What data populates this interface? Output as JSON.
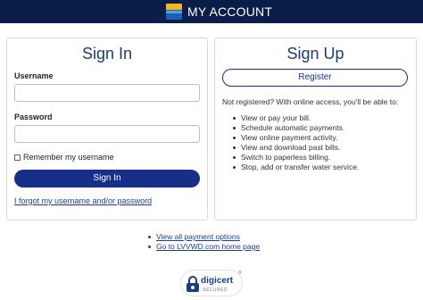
{
  "header": {
    "title": "MY ACCOUNT",
    "logo_icon": "lvvwd-logo-icon"
  },
  "signin": {
    "title": "Sign In",
    "username_label": "Username",
    "username_value": "",
    "password_label": "Password",
    "password_value": "",
    "remember_label": "Remember my username",
    "remember_checked": false,
    "button_label": "Sign In",
    "forgot_link": "I forgot my username and/or password"
  },
  "signup": {
    "title": "Sign Up",
    "button_label": "Register",
    "intro": "Not registered? With online access, you'll be able to:",
    "benefits": [
      "View or pay your bill.",
      "Schedule automatic payments.",
      "View online payment activity.",
      "View and download past bills.",
      "Switch to paperless billing.",
      "Stop, add or transfer water service."
    ]
  },
  "footer_links": [
    "View all payment options",
    "Go to LVVWD.com home page"
  ],
  "seal": {
    "name": "digicert",
    "sub": "SECURED",
    "icon": "padlock-icon"
  },
  "colors": {
    "header_bg": "#0b1e4a",
    "primary": "#16308a",
    "heading": "#1f3b73",
    "link": "#1a3f8f"
  }
}
